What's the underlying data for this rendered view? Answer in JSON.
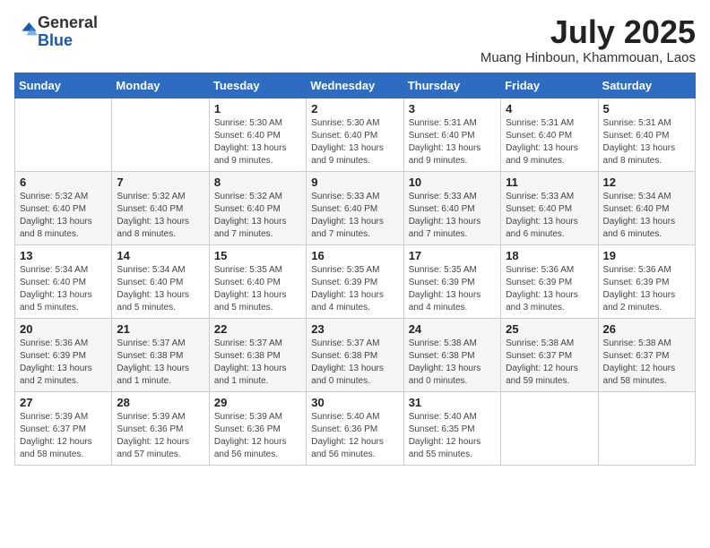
{
  "logo": {
    "general": "General",
    "blue": "Blue"
  },
  "header": {
    "title": "July 2025",
    "location": "Muang Hinboun, Khammouan, Laos"
  },
  "days_of_week": [
    "Sunday",
    "Monday",
    "Tuesday",
    "Wednesday",
    "Thursday",
    "Friday",
    "Saturday"
  ],
  "weeks": [
    [
      {
        "day": "",
        "detail": ""
      },
      {
        "day": "",
        "detail": ""
      },
      {
        "day": "1",
        "detail": "Sunrise: 5:30 AM\nSunset: 6:40 PM\nDaylight: 13 hours and 9 minutes."
      },
      {
        "day": "2",
        "detail": "Sunrise: 5:30 AM\nSunset: 6:40 PM\nDaylight: 13 hours and 9 minutes."
      },
      {
        "day": "3",
        "detail": "Sunrise: 5:31 AM\nSunset: 6:40 PM\nDaylight: 13 hours and 9 minutes."
      },
      {
        "day": "4",
        "detail": "Sunrise: 5:31 AM\nSunset: 6:40 PM\nDaylight: 13 hours and 9 minutes."
      },
      {
        "day": "5",
        "detail": "Sunrise: 5:31 AM\nSunset: 6:40 PM\nDaylight: 13 hours and 8 minutes."
      }
    ],
    [
      {
        "day": "6",
        "detail": "Sunrise: 5:32 AM\nSunset: 6:40 PM\nDaylight: 13 hours and 8 minutes."
      },
      {
        "day": "7",
        "detail": "Sunrise: 5:32 AM\nSunset: 6:40 PM\nDaylight: 13 hours and 8 minutes."
      },
      {
        "day": "8",
        "detail": "Sunrise: 5:32 AM\nSunset: 6:40 PM\nDaylight: 13 hours and 7 minutes."
      },
      {
        "day": "9",
        "detail": "Sunrise: 5:33 AM\nSunset: 6:40 PM\nDaylight: 13 hours and 7 minutes."
      },
      {
        "day": "10",
        "detail": "Sunrise: 5:33 AM\nSunset: 6:40 PM\nDaylight: 13 hours and 7 minutes."
      },
      {
        "day": "11",
        "detail": "Sunrise: 5:33 AM\nSunset: 6:40 PM\nDaylight: 13 hours and 6 minutes."
      },
      {
        "day": "12",
        "detail": "Sunrise: 5:34 AM\nSunset: 6:40 PM\nDaylight: 13 hours and 6 minutes."
      }
    ],
    [
      {
        "day": "13",
        "detail": "Sunrise: 5:34 AM\nSunset: 6:40 PM\nDaylight: 13 hours and 5 minutes."
      },
      {
        "day": "14",
        "detail": "Sunrise: 5:34 AM\nSunset: 6:40 PM\nDaylight: 13 hours and 5 minutes."
      },
      {
        "day": "15",
        "detail": "Sunrise: 5:35 AM\nSunset: 6:40 PM\nDaylight: 13 hours and 5 minutes."
      },
      {
        "day": "16",
        "detail": "Sunrise: 5:35 AM\nSunset: 6:39 PM\nDaylight: 13 hours and 4 minutes."
      },
      {
        "day": "17",
        "detail": "Sunrise: 5:35 AM\nSunset: 6:39 PM\nDaylight: 13 hours and 4 minutes."
      },
      {
        "day": "18",
        "detail": "Sunrise: 5:36 AM\nSunset: 6:39 PM\nDaylight: 13 hours and 3 minutes."
      },
      {
        "day": "19",
        "detail": "Sunrise: 5:36 AM\nSunset: 6:39 PM\nDaylight: 13 hours and 2 minutes."
      }
    ],
    [
      {
        "day": "20",
        "detail": "Sunrise: 5:36 AM\nSunset: 6:39 PM\nDaylight: 13 hours and 2 minutes."
      },
      {
        "day": "21",
        "detail": "Sunrise: 5:37 AM\nSunset: 6:38 PM\nDaylight: 13 hours and 1 minute."
      },
      {
        "day": "22",
        "detail": "Sunrise: 5:37 AM\nSunset: 6:38 PM\nDaylight: 13 hours and 1 minute."
      },
      {
        "day": "23",
        "detail": "Sunrise: 5:37 AM\nSunset: 6:38 PM\nDaylight: 13 hours and 0 minutes."
      },
      {
        "day": "24",
        "detail": "Sunrise: 5:38 AM\nSunset: 6:38 PM\nDaylight: 13 hours and 0 minutes."
      },
      {
        "day": "25",
        "detail": "Sunrise: 5:38 AM\nSunset: 6:37 PM\nDaylight: 12 hours and 59 minutes."
      },
      {
        "day": "26",
        "detail": "Sunrise: 5:38 AM\nSunset: 6:37 PM\nDaylight: 12 hours and 58 minutes."
      }
    ],
    [
      {
        "day": "27",
        "detail": "Sunrise: 5:39 AM\nSunset: 6:37 PM\nDaylight: 12 hours and 58 minutes."
      },
      {
        "day": "28",
        "detail": "Sunrise: 5:39 AM\nSunset: 6:36 PM\nDaylight: 12 hours and 57 minutes."
      },
      {
        "day": "29",
        "detail": "Sunrise: 5:39 AM\nSunset: 6:36 PM\nDaylight: 12 hours and 56 minutes."
      },
      {
        "day": "30",
        "detail": "Sunrise: 5:40 AM\nSunset: 6:36 PM\nDaylight: 12 hours and 56 minutes."
      },
      {
        "day": "31",
        "detail": "Sunrise: 5:40 AM\nSunset: 6:35 PM\nDaylight: 12 hours and 55 minutes."
      },
      {
        "day": "",
        "detail": ""
      },
      {
        "day": "",
        "detail": ""
      }
    ]
  ]
}
